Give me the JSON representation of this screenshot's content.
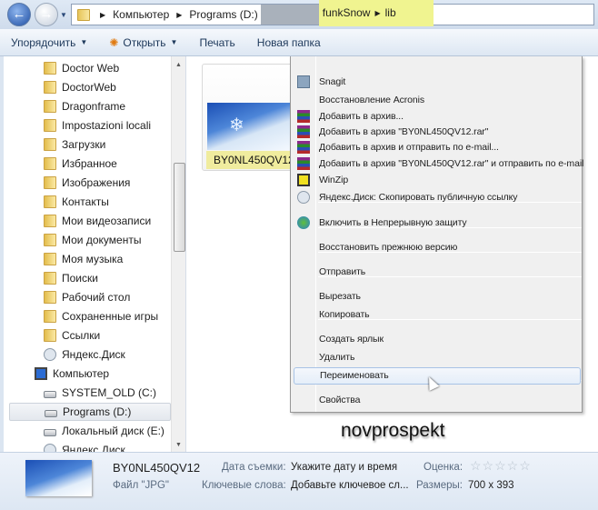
{
  "address": {
    "crumbs": [
      "Компьютер",
      "Programs (D:)"
    ],
    "highlighted_crumbs": [
      "funkSnow",
      "lib"
    ]
  },
  "toolbar": {
    "organize": "Упорядочить",
    "open": "Открыть",
    "print": "Печать",
    "new_folder": "Новая папка"
  },
  "tree": [
    {
      "label": "Doctor Web",
      "icon": "folder"
    },
    {
      "label": "DoctorWeb",
      "icon": "folder"
    },
    {
      "label": "Dragonframe",
      "icon": "folder"
    },
    {
      "label": "Impostazioni locali",
      "icon": "folder"
    },
    {
      "label": "Загрузки",
      "icon": "folder"
    },
    {
      "label": "Избранное",
      "icon": "folder"
    },
    {
      "label": "Изображения",
      "icon": "folder"
    },
    {
      "label": "Контакты",
      "icon": "folder"
    },
    {
      "label": "Мои видеозаписи",
      "icon": "folder"
    },
    {
      "label": "Мои документы",
      "icon": "folder"
    },
    {
      "label": "Моя музыка",
      "icon": "folder"
    },
    {
      "label": "Поиски",
      "icon": "folder"
    },
    {
      "label": "Рабочий стол",
      "icon": "folder"
    },
    {
      "label": "Сохраненные игры",
      "icon": "folder"
    },
    {
      "label": "Ссылки",
      "icon": "folder"
    },
    {
      "label": "Яндекс.Диск",
      "icon": "ydisk"
    },
    {
      "label": "Компьютер",
      "icon": "computer"
    },
    {
      "label": "SYSTEM_OLD (C:)",
      "icon": "drive"
    },
    {
      "label": "Programs (D:)",
      "icon": "drive",
      "selected": true
    },
    {
      "label": "Локальный диск (E:)",
      "icon": "drive"
    },
    {
      "label": "Яндекс.Диск",
      "icon": "ydisk"
    }
  ],
  "file": {
    "name": "BY0NL450QV12"
  },
  "context_menu": {
    "items": [
      {
        "label": "Snagit",
        "icon": "snagit"
      },
      {
        "label": "Восстановление Acronis"
      },
      {
        "label": "Добавить в архив...",
        "icon": "winrar"
      },
      {
        "label": "Добавить в архив \"BY0NL450QV12.rar\"",
        "icon": "winrar"
      },
      {
        "label": "Добавить в архив и отправить по e-mail...",
        "icon": "winrar"
      },
      {
        "label": "Добавить в архив \"BY0NL450QV12.rar\" и отправить по e-mail",
        "icon": "winrar"
      },
      {
        "label": "WinZip",
        "icon": "winzip"
      },
      {
        "label": "Яндекс.Диск: Скопировать публичную ссылку",
        "icon": "ydisk"
      },
      {
        "label": "Включить в Непрерывную защиту",
        "icon": "acronis"
      },
      {
        "label": "Восстановить прежнюю версию"
      },
      {
        "label": "Отправить"
      },
      {
        "label": "Вырезать"
      },
      {
        "label": "Копировать"
      },
      {
        "label": "Создать ярлык"
      },
      {
        "label": "Удалить"
      },
      {
        "label": "Переименовать",
        "hovered": true
      },
      {
        "label": "Свойства"
      }
    ]
  },
  "watermark": "novprospekt",
  "status": {
    "name": "BY0NL450QV12",
    "type": "Файл \"JPG\"",
    "date_label": "Дата съемки:",
    "date_value": "Укажите дату и время",
    "keywords_label": "Ключевые слова:",
    "keywords_value": "Добавьте ключевое сл...",
    "rating_label": "Оценка:",
    "rating": 0,
    "size_label": "Размеры:",
    "size_value": "700 x 393"
  }
}
